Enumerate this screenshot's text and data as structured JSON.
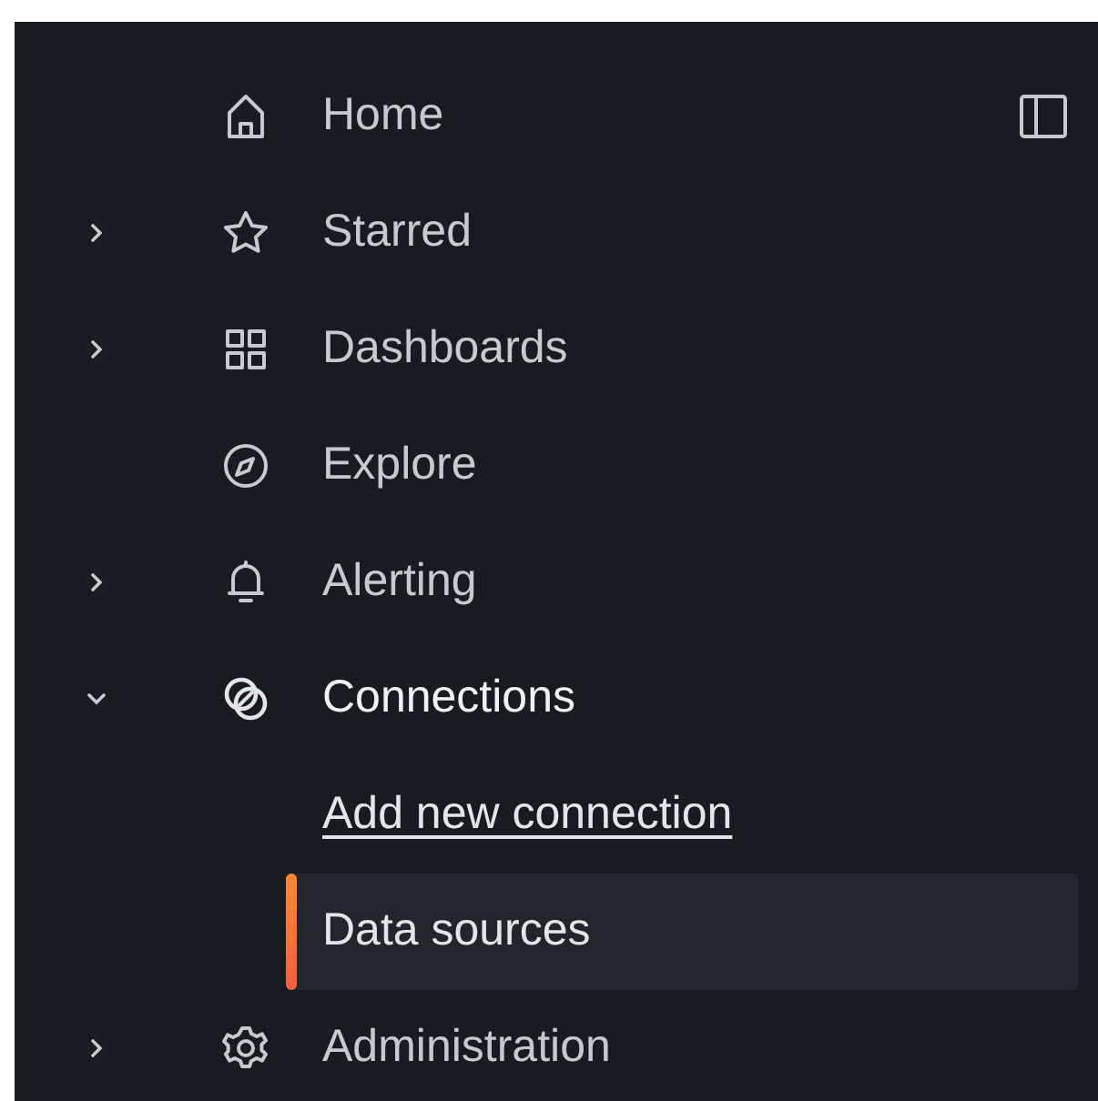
{
  "sidebar": {
    "items": [
      {
        "label": "Home",
        "kind": "plain",
        "active": false
      },
      {
        "label": "Starred",
        "kind": "expandable",
        "expanded": false,
        "active": false
      },
      {
        "label": "Dashboards",
        "kind": "expandable",
        "expanded": false,
        "active": false
      },
      {
        "label": "Explore",
        "kind": "plain",
        "active": false
      },
      {
        "label": "Alerting",
        "kind": "expandable",
        "expanded": false,
        "active": false
      },
      {
        "label": "Connections",
        "kind": "expandable",
        "expanded": true,
        "active": true,
        "children": [
          {
            "label": "Add new connection",
            "selected": false,
            "hovered": true
          },
          {
            "label": "Data sources",
            "selected": true,
            "hovered": false
          }
        ]
      },
      {
        "label": "Administration",
        "kind": "expandable",
        "expanded": false,
        "active": false
      }
    ]
  }
}
